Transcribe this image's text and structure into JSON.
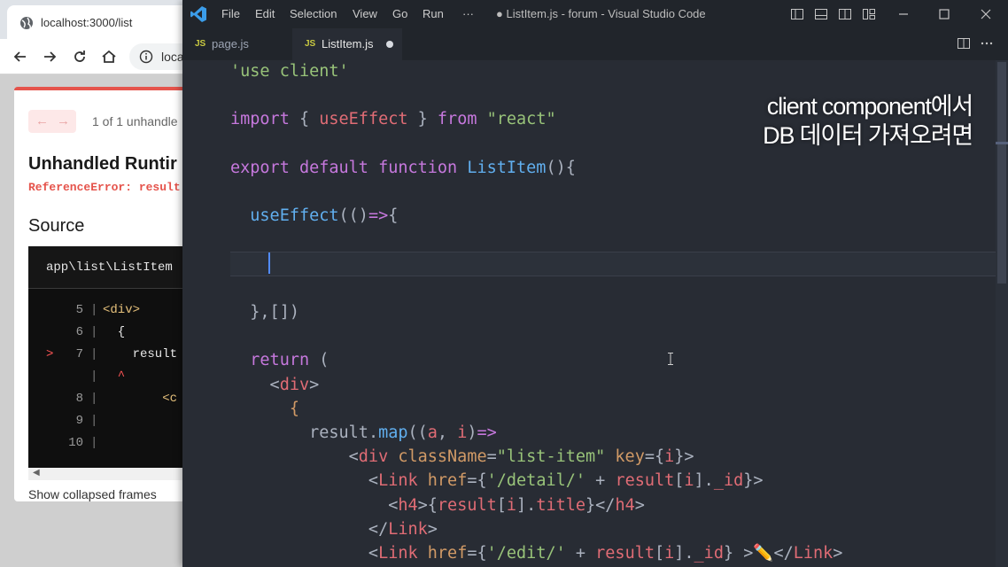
{
  "browser": {
    "tab_title": "localhost:3000/list",
    "url": "loca",
    "error_overlay": {
      "pager_prev": "←",
      "pager_next": "→",
      "count_text": "1 of 1 unhandle",
      "heading": "Unhandled Runtir",
      "message": "ReferenceError: result",
      "source_heading": "Source",
      "source_file": "app\\list\\ListItem",
      "source_lines": [
        {
          "marker": "",
          "num": "5",
          "code": "<div>",
          "color": "#e5c07b"
        },
        {
          "marker": "",
          "num": "6",
          "code": "  {",
          "color": "#e6e6e6"
        },
        {
          "marker": ">",
          "num": "7",
          "code": "    result",
          "color": "#e6e6e6"
        },
        {
          "marker": "",
          "num": "",
          "code": "  ^",
          "color": "#ff5555"
        },
        {
          "marker": "",
          "num": "8",
          "code": "        <c",
          "color": "#e5c07b"
        },
        {
          "marker": "",
          "num": "9",
          "code": "",
          "color": "#e6e6e6"
        },
        {
          "marker": "",
          "num": "10",
          "code": "",
          "color": "#e6e6e6"
        }
      ],
      "collapsed_frames": "Show collapsed frames"
    }
  },
  "vscode": {
    "menu": [
      "File",
      "Edit",
      "Selection",
      "View",
      "Go",
      "Run",
      "···"
    ],
    "window_title": "● ListItem.js - forum - Visual Studio Code",
    "tabs": [
      {
        "badge": "JS",
        "name": "page.js",
        "active": false,
        "dirty": false
      },
      {
        "badge": "JS",
        "name": "ListItem.js",
        "active": true,
        "dirty": true
      }
    ],
    "code_lines": [
      [
        {
          "t": "'use client'",
          "c": "str"
        }
      ],
      [],
      [
        {
          "t": "import",
          "c": "kw"
        },
        {
          "t": " { ",
          "c": "pl"
        },
        {
          "t": "useEffect",
          "c": "var"
        },
        {
          "t": " } ",
          "c": "pl"
        },
        {
          "t": "from",
          "c": "kw"
        },
        {
          "t": " ",
          "c": "pl"
        },
        {
          "t": "\"react\"",
          "c": "str"
        }
      ],
      [],
      [
        {
          "t": "export",
          "c": "kw"
        },
        {
          "t": " ",
          "c": "pl"
        },
        {
          "t": "default",
          "c": "kw"
        },
        {
          "t": " ",
          "c": "pl"
        },
        {
          "t": "function",
          "c": "kw"
        },
        {
          "t": " ",
          "c": "pl"
        },
        {
          "t": "ListItem",
          "c": "fn"
        },
        {
          "t": "(){",
          "c": "pl"
        }
      ],
      [],
      [
        {
          "t": "  ",
          "c": "pl"
        },
        {
          "t": "useEffect",
          "c": "fn"
        },
        {
          "t": "(()",
          "c": "pl"
        },
        {
          "t": "=>",
          "c": "kw"
        },
        {
          "t": "{",
          "c": "pl"
        }
      ],
      [],
      [
        {
          "t": "  ",
          "c": "pl"
        }
      ],
      [],
      [
        {
          "t": "  },[])",
          "c": "pl"
        }
      ],
      [],
      [
        {
          "t": "  ",
          "c": "pl"
        },
        {
          "t": "return",
          "c": "kw"
        },
        {
          "t": " (",
          "c": "pl"
        }
      ],
      [
        {
          "t": "    <",
          "c": "pl"
        },
        {
          "t": "div",
          "c": "tag"
        },
        {
          "t": ">",
          "c": "pl"
        }
      ],
      [
        {
          "t": "      {",
          "c": "br"
        }
      ],
      [
        {
          "t": "        ",
          "c": "pl"
        },
        {
          "t": "result",
          "c": "pl"
        },
        {
          "t": ".",
          "c": "pl"
        },
        {
          "t": "map",
          "c": "fn"
        },
        {
          "t": "((",
          "c": "pl"
        },
        {
          "t": "a",
          "c": "var"
        },
        {
          "t": ", ",
          "c": "pl"
        },
        {
          "t": "i",
          "c": "var"
        },
        {
          "t": ")",
          "c": "pl"
        },
        {
          "t": "=>",
          "c": "kw"
        }
      ],
      [
        {
          "t": "            <",
          "c": "pl"
        },
        {
          "t": "div",
          "c": "tag"
        },
        {
          "t": " ",
          "c": "pl"
        },
        {
          "t": "className",
          "c": "attr"
        },
        {
          "t": "=",
          "c": "pl"
        },
        {
          "t": "\"list-item\"",
          "c": "str"
        },
        {
          "t": " ",
          "c": "pl"
        },
        {
          "t": "key",
          "c": "attr"
        },
        {
          "t": "={",
          "c": "pl"
        },
        {
          "t": "i",
          "c": "var"
        },
        {
          "t": "}>",
          "c": "pl"
        }
      ],
      [
        {
          "t": "              <",
          "c": "pl"
        },
        {
          "t": "Link",
          "c": "tag"
        },
        {
          "t": " ",
          "c": "pl"
        },
        {
          "t": "href",
          "c": "attr"
        },
        {
          "t": "={",
          "c": "pl"
        },
        {
          "t": "'/detail/'",
          "c": "str"
        },
        {
          "t": " + ",
          "c": "pl"
        },
        {
          "t": "result",
          "c": "var"
        },
        {
          "t": "[",
          "c": "pl"
        },
        {
          "t": "i",
          "c": "var"
        },
        {
          "t": "].",
          "c": "pl"
        },
        {
          "t": "_id",
          "c": "var"
        },
        {
          "t": "}>",
          "c": "pl"
        }
      ],
      [
        {
          "t": "                <",
          "c": "pl"
        },
        {
          "t": "h4",
          "c": "tag"
        },
        {
          "t": ">{",
          "c": "pl"
        },
        {
          "t": "result",
          "c": "var"
        },
        {
          "t": "[",
          "c": "pl"
        },
        {
          "t": "i",
          "c": "var"
        },
        {
          "t": "].",
          "c": "pl"
        },
        {
          "t": "title",
          "c": "var"
        },
        {
          "t": "}</",
          "c": "pl"
        },
        {
          "t": "h4",
          "c": "tag"
        },
        {
          "t": ">",
          "c": "pl"
        }
      ],
      [
        {
          "t": "              </",
          "c": "pl"
        },
        {
          "t": "Link",
          "c": "tag"
        },
        {
          "t": ">",
          "c": "pl"
        }
      ],
      [
        {
          "t": "              <",
          "c": "pl"
        },
        {
          "t": "Link",
          "c": "tag"
        },
        {
          "t": " ",
          "c": "pl"
        },
        {
          "t": "href",
          "c": "attr"
        },
        {
          "t": "={",
          "c": "pl"
        },
        {
          "t": "'/edit/'",
          "c": "str"
        },
        {
          "t": " + ",
          "c": "pl"
        },
        {
          "t": "result",
          "c": "var"
        },
        {
          "t": "[",
          "c": "pl"
        },
        {
          "t": "i",
          "c": "var"
        },
        {
          "t": "].",
          "c": "pl"
        },
        {
          "t": "_id",
          "c": "var"
        },
        {
          "t": "} >",
          "c": "pl"
        },
        {
          "t": "✏️",
          "c": "pen"
        },
        {
          "t": "</",
          "c": "pl"
        },
        {
          "t": "Link",
          "c": "tag"
        },
        {
          "t": ">",
          "c": "pl"
        }
      ]
    ]
  },
  "caption": {
    "line1": "client component에서",
    "line2": "DB 데이터 가져오려면"
  },
  "icons": [
    "globe-icon",
    "back-arrow-icon",
    "forward-arrow-icon",
    "reload-icon",
    "home-icon",
    "info-icon",
    "vscode-logo-icon",
    "split-editor-icon",
    "more-actions-icon",
    "layout-icons",
    "minimize-icon",
    "maximize-icon",
    "close-icon"
  ],
  "colors": {
    "error_accent": "#e5534b",
    "editor_bg": "#282c34",
    "caret": "#528bff"
  }
}
